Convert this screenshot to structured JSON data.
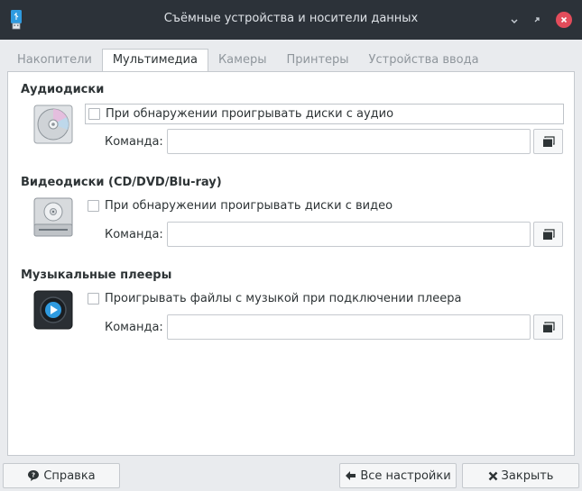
{
  "window": {
    "title": "Съёмные устройства и носители данных",
    "app_icon": "usb-drive-icon"
  },
  "tabs": [
    {
      "label": "Накопители",
      "active": false
    },
    {
      "label": "Мультимедиа",
      "active": true
    },
    {
      "label": "Камеры",
      "active": false
    },
    {
      "label": "Принтеры",
      "active": false
    },
    {
      "label": "Устройства ввода",
      "active": false
    }
  ],
  "sections": {
    "audio": {
      "title": "Аудиодиски",
      "icon": "audio-cd-icon",
      "checkbox_label": "При обнаружении проигрывать диски с аудио",
      "checked": false,
      "command_label": "Команда:",
      "command_value": ""
    },
    "video": {
      "title": "Видеодиски (CD/DVD/Blu-ray)",
      "icon": "optical-drive-icon",
      "checkbox_label": "При обнаружении проигрывать диски с видео",
      "checked": false,
      "command_label": "Команда:",
      "command_value": ""
    },
    "player": {
      "title": "Музыкальные плееры",
      "icon": "media-player-icon",
      "checkbox_label": "Проигрывать файлы с музыкой при подключении плеера",
      "checked": false,
      "command_label": "Команда:",
      "command_value": ""
    }
  },
  "buttons": {
    "help": "Справка",
    "all_settings": "Все настройки",
    "close": "Закрыть"
  },
  "colors": {
    "titlebar": "#2c3239",
    "close_button": "#e34c5b",
    "accent_usb": "#2f9be0"
  }
}
